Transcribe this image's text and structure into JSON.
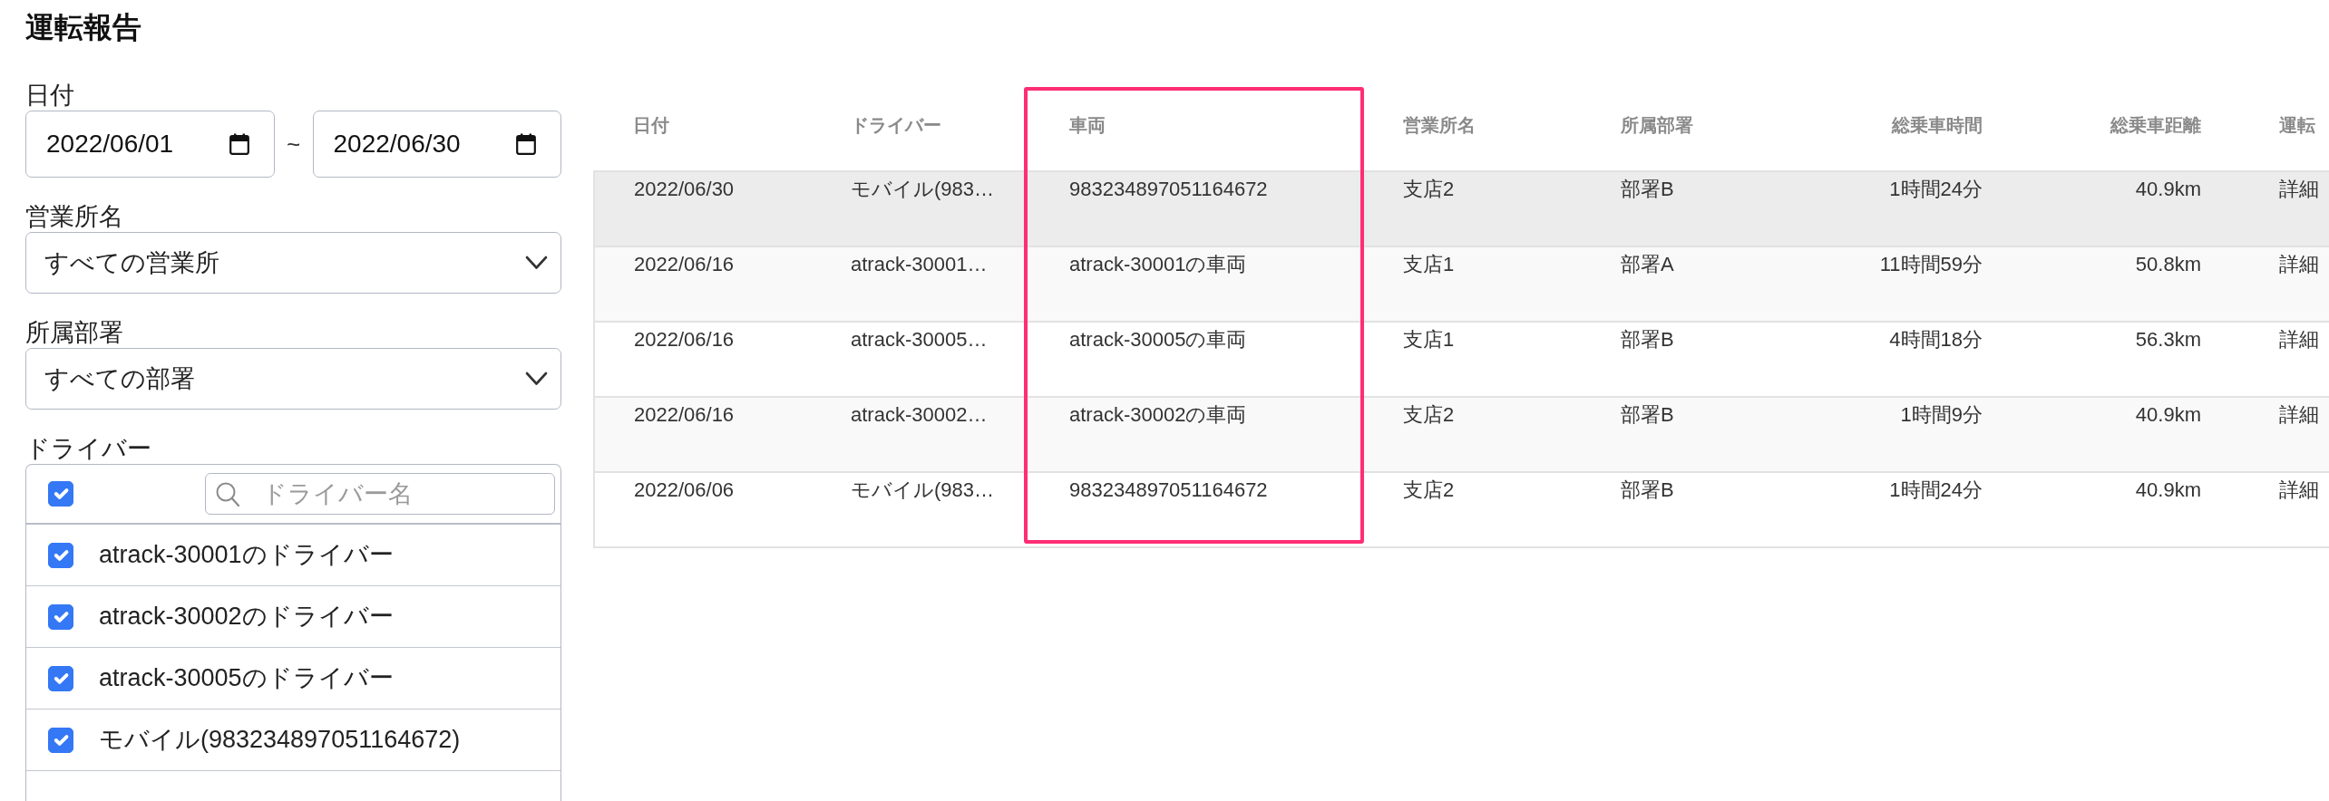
{
  "page": {
    "title": "運転報告"
  },
  "filters": {
    "date": {
      "label": "日付",
      "from": "2022/06/01",
      "separator": "~",
      "to": "2022/06/30"
    },
    "office": {
      "label": "営業所名",
      "value": "すべての営業所"
    },
    "department": {
      "label": "所属部署",
      "value": "すべての部署"
    },
    "drivers": {
      "label": "ドライバー",
      "select_all": {
        "checked": true
      },
      "search": {
        "placeholder": "ドライバー名"
      },
      "items": [
        {
          "name": "atrack-30001のドライバー",
          "checked": true
        },
        {
          "name": "atrack-30002のドライバー",
          "checked": true
        },
        {
          "name": "atrack-30005のドライバー",
          "checked": true
        },
        {
          "name": "モバイル(983234897051164672)",
          "checked": true
        }
      ]
    }
  },
  "table": {
    "columns": [
      {
        "label": "日付",
        "kind": "text",
        "highlighted": false
      },
      {
        "label": "ドライバー",
        "kind": "text",
        "highlighted": false
      },
      {
        "label": "車両",
        "kind": "text",
        "highlighted": true
      },
      {
        "label": "営業所名",
        "kind": "text",
        "highlighted": false
      },
      {
        "label": "所属部署",
        "kind": "text",
        "highlighted": false
      },
      {
        "label": "総乗車時間",
        "kind": "number",
        "highlighted": false
      },
      {
        "label": "総乗車距離",
        "kind": "number",
        "highlighted": false
      },
      {
        "label": "運転",
        "kind": "link",
        "highlighted": false
      }
    ],
    "rows": [
      {
        "selected": true,
        "cells": [
          "2022/06/30",
          "モバイル(983…",
          "983234897051164672",
          "支店2",
          "部署B",
          "1時間24分",
          "40.9km",
          "詳細"
        ]
      },
      {
        "selected": false,
        "cells": [
          "2022/06/16",
          "atrack-30001…",
          "atrack-30001の車両",
          "支店1",
          "部署A",
          "11時間59分",
          "50.8km",
          "詳細"
        ]
      },
      {
        "selected": false,
        "cells": [
          "2022/06/16",
          "atrack-30005…",
          "atrack-30005の車両",
          "支店1",
          "部署B",
          "4時間18分",
          "56.3km",
          "詳細"
        ]
      },
      {
        "selected": false,
        "cells": [
          "2022/06/16",
          "atrack-30002…",
          "atrack-30002の車両",
          "支店2",
          "部署B",
          "1時間9分",
          "40.9km",
          "詳細"
        ]
      },
      {
        "selected": false,
        "cells": [
          "2022/06/06",
          "モバイル(983…",
          "983234897051164672",
          "支店2",
          "部署B",
          "1時間24分",
          "40.9km",
          "詳細"
        ]
      }
    ]
  }
}
